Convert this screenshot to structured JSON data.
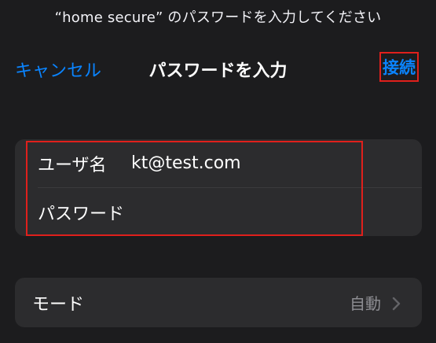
{
  "dialog": {
    "prompt": "“home secure” のパスワードを入力してください"
  },
  "navbar": {
    "cancel_label": "キャンセル",
    "title": "パスワードを入力",
    "connect_label": "接続"
  },
  "credentials": {
    "username_label": "ユーザ名",
    "username_value": "kt@test.com",
    "password_label": "パスワード",
    "password_value": ""
  },
  "mode": {
    "label": "モード",
    "value": "自動",
    "chevron_icon": "chevron-right-icon"
  },
  "colors": {
    "background": "#1c1c1e",
    "group_background": "#2c2c2e",
    "accent": "#0a84ff",
    "highlight": "#e0201c",
    "secondary_text": "#8e8e93"
  }
}
